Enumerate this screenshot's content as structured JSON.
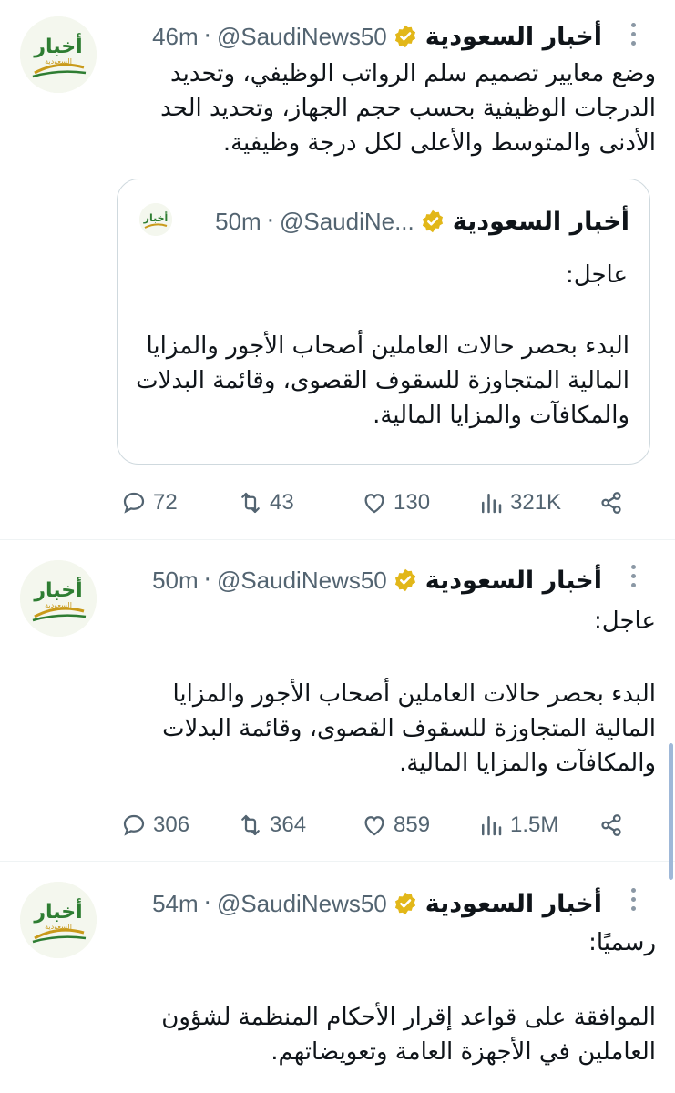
{
  "brand": {
    "accent": "#536471",
    "verified_color": "#e2b719",
    "avatar_text": "أخبار",
    "avatar_subtext": "السعودية"
  },
  "tweets": [
    {
      "name": "أخبار السعودية",
      "handle": "@SaudiNews50",
      "dot": "·",
      "time": "46m",
      "text": "وضع معايير تصميم سلم الرواتب الوظيفي، وتحديد الدرجات الوظيفية بحسب حجم الجهاز، وتحديد الحد الأدنى والمتوسط والأعلى لكل درجة وظيفية.",
      "quote": {
        "name": "أخبار السعودية",
        "handle": "@SaudiNe...",
        "dot": "·",
        "time": "50m",
        "line1": "عاجل:",
        "text": "البدء بحصر حالات العاملين أصحاب الأجور والمزايا المالية المتجاوزة للسقوف القصوى، وقائمة البدلات والمكافآت والمزايا المالية."
      },
      "replies": "72",
      "retweets": "43",
      "likes": "130",
      "views": "321K"
    },
    {
      "name": "أخبار السعودية",
      "handle": "@SaudiNews50",
      "dot": "·",
      "time": "50m",
      "line1": "عاجل:",
      "text": "البدء بحصر حالات العاملين أصحاب الأجور والمزايا المالية المتجاوزة للسقوف القصوى، وقائمة البدلات والمكافآت والمزايا المالية.",
      "replies": "306",
      "retweets": "364",
      "likes": "859",
      "views": "1.5M"
    },
    {
      "name": "أخبار السعودية",
      "handle": "@SaudiNews50",
      "dot": "·",
      "time": "54m",
      "line1": "رسميًا:",
      "text": "الموافقة على قواعد إقرار الأحكام المنظمة لشؤون العاملين في الأجهزة العامة وتعويضاتهم."
    }
  ]
}
